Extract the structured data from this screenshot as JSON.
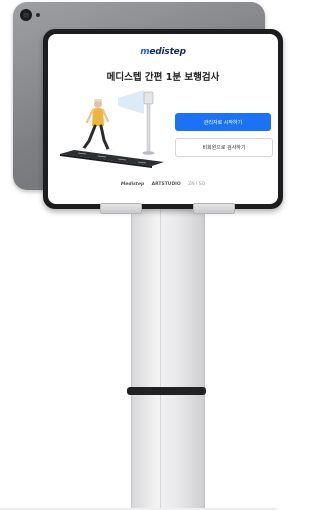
{
  "app": {
    "logo_prefix": "m",
    "logo_text": "edistep",
    "title": "메디스텝 간편 1분 보행검사"
  },
  "buttons": {
    "primary_label": "관리자로 시작하기",
    "secondary_label": "비회원으로 검사하기"
  },
  "footer": {
    "partners": [
      "Medistep",
      "ARTSTUDIO",
      "ZN I SQ"
    ]
  },
  "colors": {
    "accent": "#1b73f4",
    "brand_navy": "#1a2a5a",
    "device_body": "#1d1d1f",
    "mat": "#2e2f33"
  },
  "icons": [
    "camera-icon",
    "walking-person-illustration",
    "gait-mat-illustration",
    "sensor-kiosk-illustration"
  ]
}
